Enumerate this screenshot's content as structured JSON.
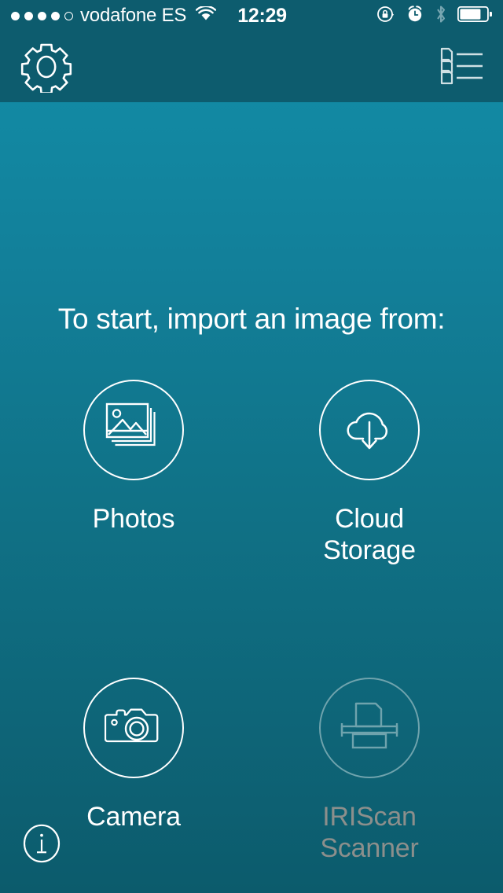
{
  "status_bar": {
    "signal_dots_total": 5,
    "signal_dots_filled": 4,
    "carrier": "vodafone ES",
    "wifi_icon": "wifi-icon",
    "time": "12:29",
    "right_icons": [
      {
        "name": "rotation-lock-icon",
        "dimmed": false
      },
      {
        "name": "alarm-clock-icon",
        "dimmed": false
      },
      {
        "name": "bluetooth-icon",
        "dimmed": true
      },
      {
        "name": "battery-icon",
        "dimmed": false
      }
    ],
    "battery_level_percent": 75
  },
  "nav_bar": {
    "settings_icon": "gear-icon",
    "documents_icon": "documents-list-icon"
  },
  "main": {
    "headline": "To start, import an image from:",
    "sources": [
      {
        "label": "Photos",
        "icon": "photos-stack-icon",
        "enabled": true
      },
      {
        "label": "Cloud Storage",
        "icon": "cloud-download-icon",
        "enabled": true
      },
      {
        "label": "Camera",
        "icon": "camera-icon",
        "enabled": true
      },
      {
        "label": "IRIScan\nScanner",
        "icon": "scanner-icon",
        "enabled": false
      }
    ]
  },
  "footer": {
    "info_icon": "info-icon"
  },
  "colors": {
    "header_bg": "#0d5c6e",
    "gradient_top": "#1289a3",
    "gradient_bottom": "#0c5b6c",
    "accent_white": "#ffffff",
    "disabled_icon": "#6fa3ad",
    "disabled_text": "#8c8f8c"
  }
}
